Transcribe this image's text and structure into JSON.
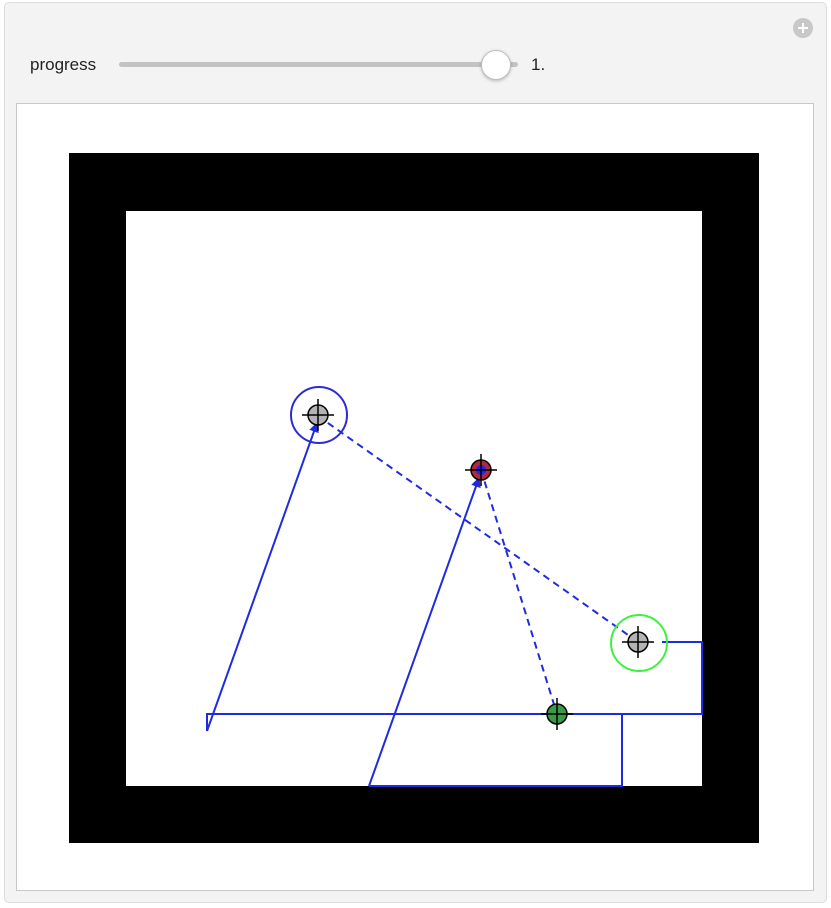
{
  "controls": {
    "slider_label": "progress",
    "slider_value_text": "1.",
    "slider_value": 1.0
  },
  "icons": {
    "add_control": "plus-circle-icon",
    "target": "crosshair-icon"
  },
  "colors": {
    "path": "#1f2be0",
    "frame": "#000000",
    "blue_ring": "#2e2ad4",
    "green_ring": "#3df23d",
    "gray_fill": "#b4b4b4",
    "green_fill": "#3a9a4a",
    "red_fill": "#b02a3a",
    "dot_blue": "#2020ff"
  }
}
